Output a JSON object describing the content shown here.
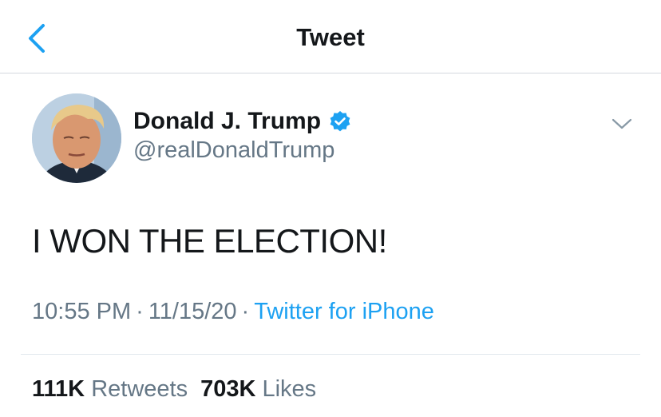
{
  "nav": {
    "title": "Tweet"
  },
  "author": {
    "name": "Donald J. Trump",
    "handle": "@realDonaldTrump",
    "verified": true
  },
  "tweet": {
    "text": "I WON THE ELECTION!",
    "time": "10:55 PM",
    "date": "11/15/20",
    "source": "Twitter for iPhone"
  },
  "stats": {
    "retweets_count": "111K",
    "retweets_label": "Retweets",
    "likes_count": "703K",
    "likes_label": "Likes"
  },
  "colors": {
    "accent": "#1da1f2",
    "text_primary": "#14171a",
    "text_secondary": "#657786",
    "divider": "#e1e8ed"
  },
  "icons": {
    "back": "chevron-left-icon",
    "verified": "verified-badge-icon",
    "more": "chevron-down-icon"
  }
}
